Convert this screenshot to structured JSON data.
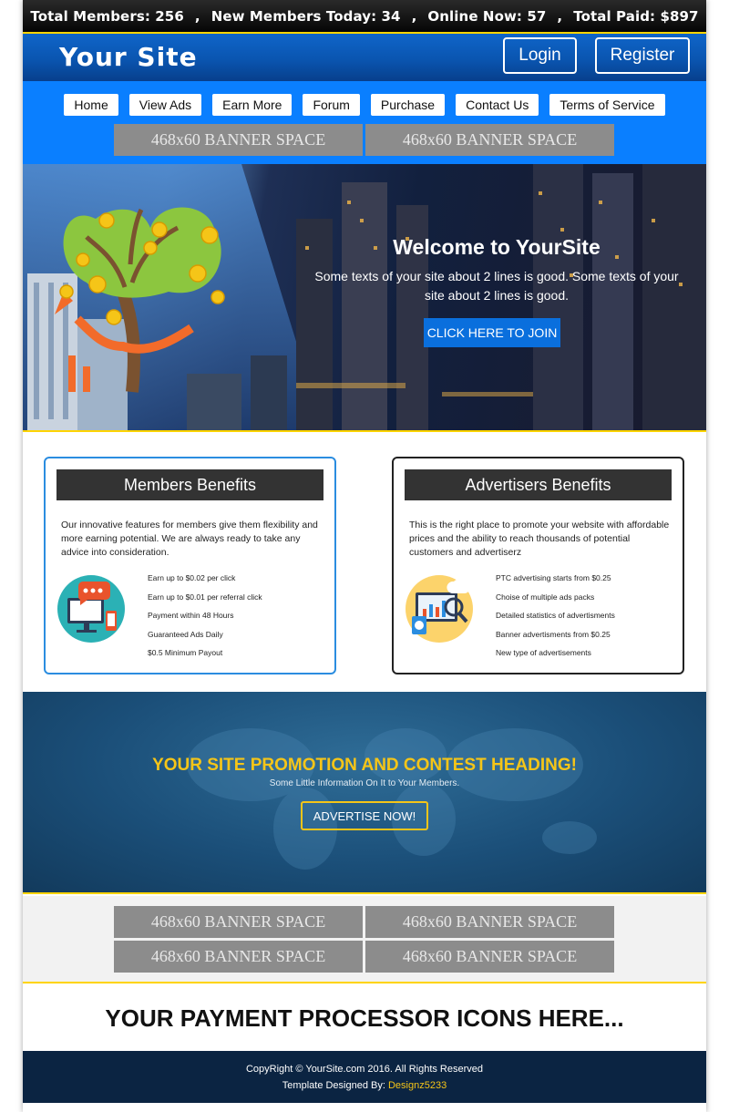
{
  "stats": {
    "total_members": "Total Members: 256",
    "new_members": "New Members Today: 34",
    "online_now": "Online Now: 57",
    "total_paid": "Total Paid: $897",
    "separator": ","
  },
  "header": {
    "logo": "Your Site",
    "login_label": "Login",
    "register_label": "Register"
  },
  "nav": {
    "items": [
      "Home",
      "View Ads",
      "Earn More",
      "Forum",
      "Purchase",
      "Contact Us",
      "Terms of Service"
    ]
  },
  "banners": {
    "label": "468x60 BANNER SPACE"
  },
  "hero": {
    "title": "Welcome to YourSite",
    "subtitle": "Some texts of your site about 2 lines is good. Some texts of your site about 2 lines is good.",
    "cta": "CLICK HERE TO JOIN"
  },
  "members_benefits": {
    "title": "Members Benefits",
    "description": "Our innovative features for members give them flexibility and more earning potential. We are always ready to take any advice into consideration.",
    "items": [
      "Earn up to $0.02 per click",
      "Earn up to $0.01 per referral click",
      "Payment within 48 Hours",
      "Guaranteed Ads Daily",
      "$0.5 Minimum Payout"
    ]
  },
  "advertisers_benefits": {
    "title": "Advertisers Benefits",
    "description": "This is the right place to promote your website with affordable prices and the ability to reach thousands of potential customers and advertiserz",
    "items": [
      "PTC advertising starts from $0.25",
      "Choise of multiple ads packs",
      "Detailed statistics of advertisments",
      "Banner advertisments from $0.25",
      "New type of advertisements"
    ]
  },
  "promo": {
    "title": "YOUR SITE PROMOTION AND CONTEST HEADING!",
    "subtitle": "Some Little Information On It to Your Members.",
    "button": "ADVERTISE NOW!"
  },
  "payment": {
    "text": "YOUR PAYMENT PROCESSOR ICONS HERE..."
  },
  "footer": {
    "copyright": "CopyRight © YourSite.com 2016. All Rights Reserved",
    "designed_by": "Template Designed By:",
    "designer": "Designz5233"
  },
  "colors": {
    "accent_blue": "#0a7fff",
    "gold": "#f5c518",
    "dark": "#333333"
  }
}
